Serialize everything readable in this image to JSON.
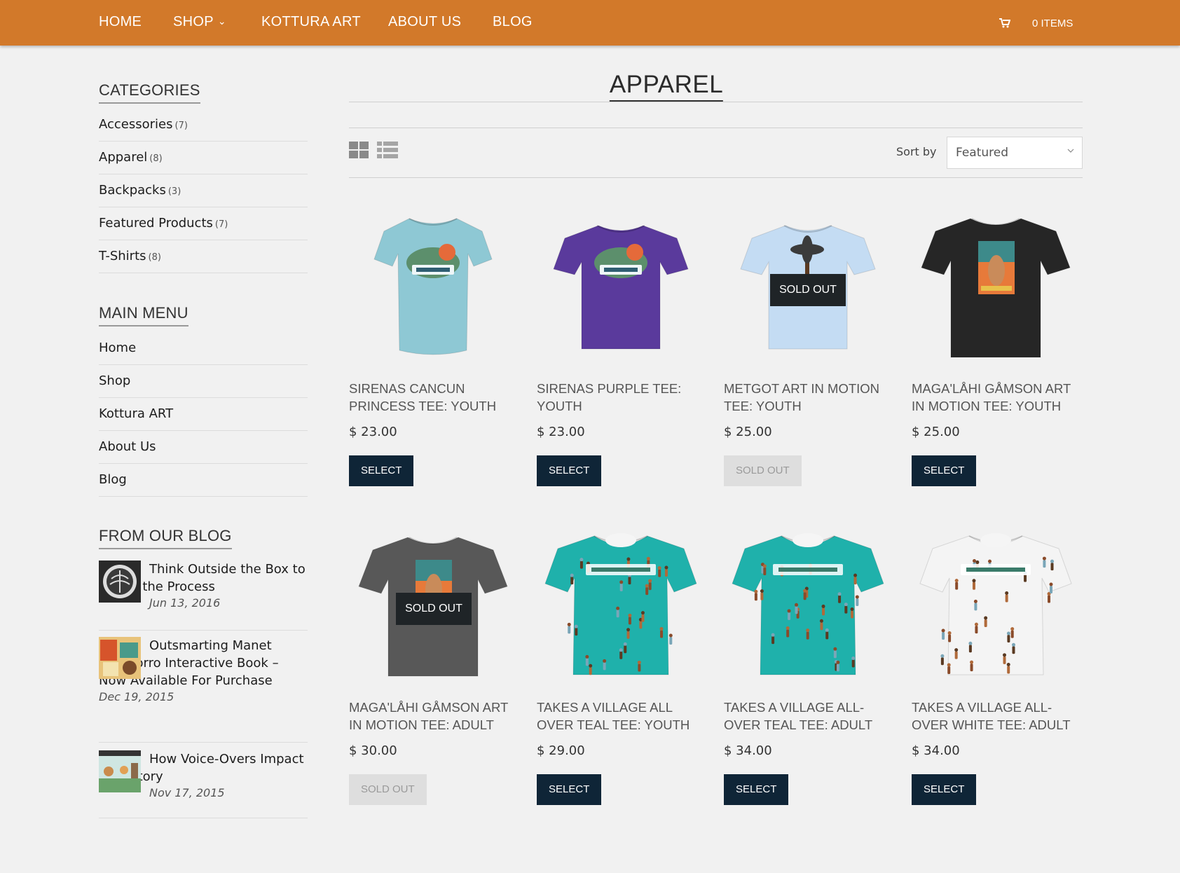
{
  "nav": {
    "items": [
      {
        "label": "HOME"
      },
      {
        "label": "SHOP"
      },
      {
        "label": "KOTTURA ART"
      },
      {
        "label": "ABOUT US"
      },
      {
        "label": "BLOG"
      }
    ],
    "cart_label": "0 ITEMS",
    "accent": "#d2792a"
  },
  "sidebar": {
    "categories_heading": "CATEGORIES",
    "categories": [
      {
        "label": "Accessories",
        "count": "(7)"
      },
      {
        "label": "Apparel",
        "count": "(8)"
      },
      {
        "label": "Backpacks",
        "count": "(3)"
      },
      {
        "label": "Featured Products",
        "count": "(7)"
      },
      {
        "label": "T-Shirts",
        "count": "(8)"
      }
    ],
    "menu_heading": "MAIN MENU",
    "menu": [
      {
        "label": "Home"
      },
      {
        "label": "Shop"
      },
      {
        "label": "Kottura ART"
      },
      {
        "label": "About Us"
      },
      {
        "label": "Blog"
      }
    ],
    "blog_heading": "FROM OUR BLOG",
    "posts": [
      {
        "title": "Think Outside the Box to Refine the Process",
        "date": "Jun 13, 2016"
      },
      {
        "title": "Outsmarting Manet Chamorro Interactive Book – Now Available For Purchase",
        "date": "Dec 19, 2015"
      },
      {
        "title": "How Voice-Overs Impact Your Story",
        "date": "Nov 17, 2015"
      }
    ]
  },
  "main": {
    "title": "APPAREL",
    "sort_label": "Sort by",
    "sort_value": "Featured",
    "sold_out_overlay": "SOLD OUT",
    "products": [
      {
        "title": "SIRENAS CANCUN PRINCESS TEE: YOUTH",
        "price": "$ 23.00",
        "button": "SELECT",
        "sold_out": false
      },
      {
        "title": "SIRENAS PURPLE TEE: YOUTH",
        "price": "$ 23.00",
        "button": "SELECT",
        "sold_out": false
      },
      {
        "title": "METGOT ART IN MOTION TEE: YOUTH",
        "price": "$ 25.00",
        "button": "SOLD OUT",
        "sold_out": true
      },
      {
        "title": "MAGA'LÅHI GÅMSON ART IN MOTION TEE: YOUTH",
        "price": "$ 25.00",
        "button": "SELECT",
        "sold_out": false
      },
      {
        "title": "MAGA'LÅHI GÅMSON ART IN MOTION TEE: ADULT",
        "price": "$ 30.00",
        "button": "SOLD OUT",
        "sold_out": true
      },
      {
        "title": "TAKES A VILLAGE ALL OVER TEAL TEE: YOUTH",
        "price": "$ 29.00",
        "button": "SELECT",
        "sold_out": false
      },
      {
        "title": "TAKES A VILLAGE ALL-OVER TEAL TEE: ADULT",
        "price": "$ 34.00",
        "button": "SELECT",
        "sold_out": false
      },
      {
        "title": "TAKES A VILLAGE ALL-OVER WHITE TEE: ADULT",
        "price": "$ 34.00",
        "button": "SELECT",
        "sold_out": false
      }
    ],
    "shirt_colors": [
      "#8ec8d4",
      "#5a3a9c",
      "#c4dcf3",
      "#262626",
      "#585858",
      "#1fb1ab",
      "#1fb1ab",
      "#f4f4f4"
    ],
    "button_color": "#0f2537"
  }
}
